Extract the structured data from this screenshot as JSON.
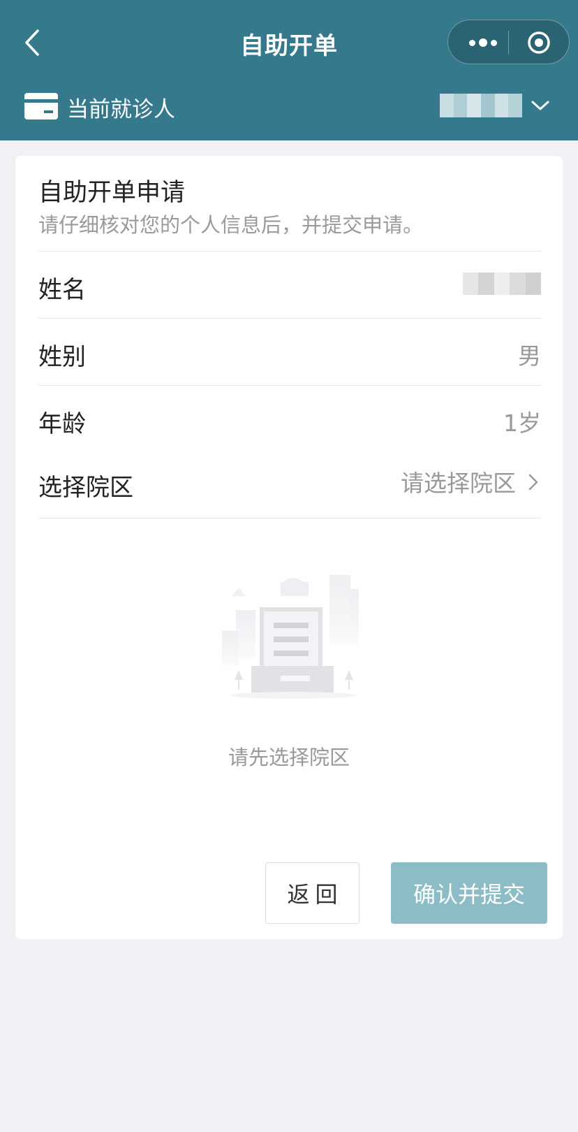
{
  "nav": {
    "title": "自助开单"
  },
  "patient": {
    "label": "当前就诊人"
  },
  "form": {
    "title": "自助开单申请",
    "subtitle": "请仔细核对您的个人信息后，并提交申请。",
    "rows": [
      {
        "label": "姓名",
        "value": ""
      },
      {
        "label": "姓别",
        "value": "男"
      },
      {
        "label": "年龄",
        "value": "1岁"
      },
      {
        "label": "选择院区",
        "value": "请选择院区"
      }
    ]
  },
  "empty": {
    "text": "请先选择院区"
  },
  "actions": {
    "back_label": "返回",
    "submit_label": "确认并提交"
  },
  "colors": {
    "header_bg": "#347a8c",
    "submit_bg": "#8cbcc5",
    "page_bg": "#f0f1f4"
  }
}
